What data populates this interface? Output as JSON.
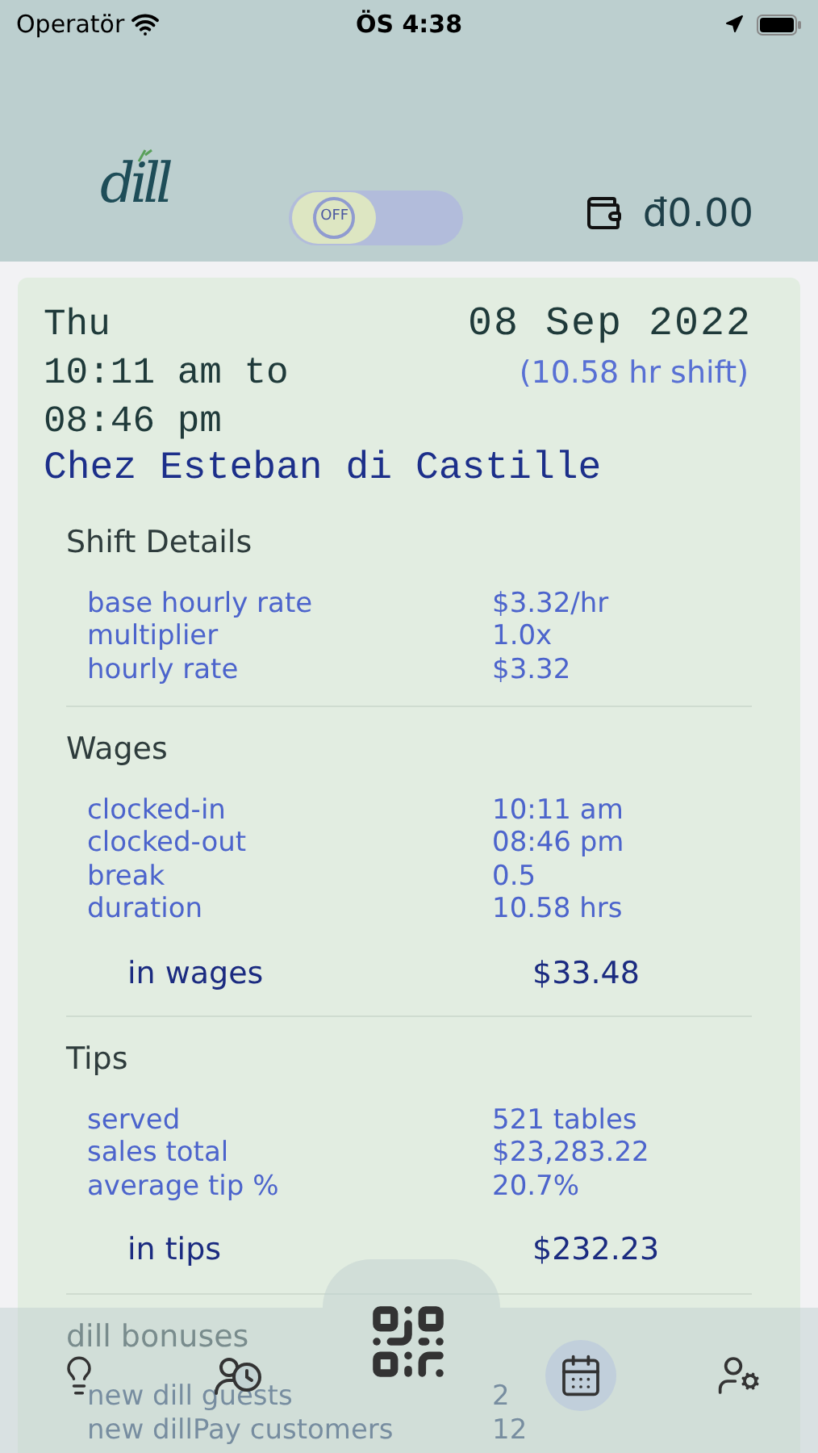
{
  "status_bar": {
    "carrier": "Operatör",
    "time": "ÖS 4:38"
  },
  "header": {
    "logo": "dill",
    "toggle": {
      "label": "OFF",
      "on": false
    },
    "balance": "đ0.00"
  },
  "shift": {
    "day": "Thu",
    "date": "08 Sep 2022",
    "time_range": "10:11 am to 08:46 pm",
    "duration": "(10.58 hr shift)",
    "venue": "Chez Esteban di Castille"
  },
  "sections": [
    {
      "title": "Shift Details",
      "rows": [
        {
          "label": "base hourly rate",
          "value": "$3.32/hr"
        },
        {
          "label": "multiplier",
          "value": "1.0x"
        },
        {
          "label": "hourly rate",
          "value": "$3.32"
        }
      ]
    },
    {
      "title": "Wages",
      "rows": [
        {
          "label": "clocked-in",
          "value": "10:11 am"
        },
        {
          "label": "clocked-out",
          "value": "08:46 pm"
        },
        {
          "label": "break",
          "value": "0.5"
        },
        {
          "label": "duration",
          "value": "10.58 hrs"
        }
      ],
      "total": {
        "label": "in wages",
        "value": "$33.48"
      }
    },
    {
      "title": "Tips",
      "rows": [
        {
          "label": "served",
          "value": "521 tables"
        },
        {
          "label": "sales total",
          "value": "$23,283.22"
        },
        {
          "label": "average tip %",
          "value": "20.7%"
        }
      ],
      "total": {
        "label": "in tips",
        "value": "$232.23"
      }
    },
    {
      "title": "dill bonuses",
      "rows": [
        {
          "label": "new dill guests",
          "value": "2"
        },
        {
          "label": "new dillPay customers",
          "value": "12"
        }
      ]
    }
  ],
  "tab_bar": [
    {
      "kind": "tips",
      "selected": false
    },
    {
      "kind": "history",
      "selected": false
    },
    {
      "kind": "qr",
      "selected": false
    },
    {
      "kind": "calendar",
      "selected": true
    },
    {
      "kind": "settings",
      "selected": false
    }
  ]
}
